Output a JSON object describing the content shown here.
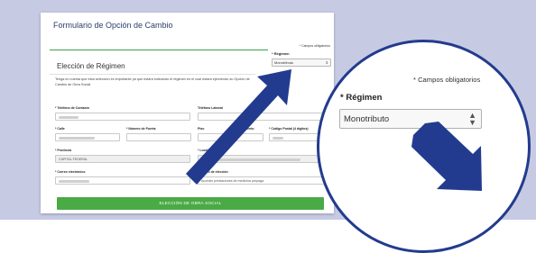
{
  "form": {
    "title": "Formulario de Opción de Cambio",
    "required_note": "* Campos obligatorios",
    "regimen_label": "* Régimen",
    "regimen_value": "Monotributo",
    "section_title": "Elección de Régimen",
    "info_text": "Tenga en cuenta que esta selección es importante ya que estará indicando el régimen en el cual estará ejerciendo su Opción de Cambio de Obra Social.",
    "labels": {
      "telefono_contacto": "* Teléfono de Contacto",
      "telefono_laboral": "Teléfono Laboral",
      "calle": "* Calle",
      "numero_puerta": "* Número de Puerta",
      "piso": "Piso",
      "departamento": "Departamento",
      "codigo_postal": "* Código Postal (4 dígitos)",
      "provincia": "* Provincia",
      "localidad": "* Localidad",
      "correo": "* Correo electrónico",
      "motivo": "* Motivo de elección"
    },
    "values": {
      "provincia": "CAPITAL FEDERAL",
      "motivo": "Acceder prestaciones de medicina prepaga"
    },
    "submit_label": "ELECCIÓN DE OBRA SOCIAL"
  },
  "magnifier": {
    "required_note": "* Campos obligatorios",
    "regimen_label": "* Régimen",
    "regimen_value": "Monotributo",
    "select_arrow": "▲▼"
  },
  "colors": {
    "background_band": "#c6cae3",
    "accent_green": "#4aaa45",
    "arrow_blue": "#233b8e",
    "title_blue": "#2c3e6b"
  }
}
